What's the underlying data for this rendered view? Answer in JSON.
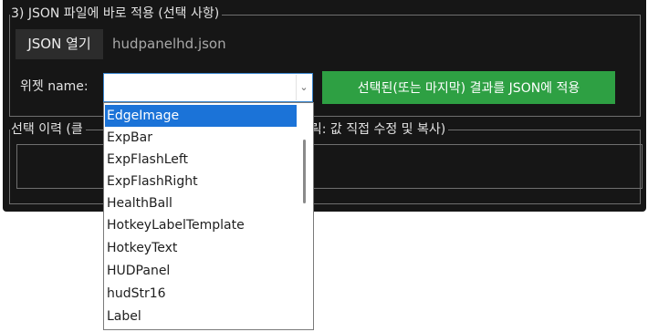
{
  "json_section": {
    "title": "3) JSON 파일에 바로 적용 (선택 사항)",
    "open_button_label": "JSON 열기",
    "filename": "hudpanelhd.json",
    "widget_name_label": "위젯 name:",
    "widget_name_value": "",
    "dropdown_arrow_icon": "chevron-down-icon",
    "apply_button_label": "선택된(또는 마지막) 결과를 JSON에 적용",
    "apply_button_color": "#2ea043"
  },
  "history_section": {
    "title_left": "선택 이력 (클",
    "title_right": "클릭: 값 직접 수정 및 복사)"
  },
  "dropdown": {
    "items": [
      "EdgeImage",
      "ExpBar",
      "ExpFlashLeft",
      "ExpFlashRight",
      "HealthBall",
      "HotkeyLabelTemplate",
      "HotkeyText",
      "HUDPanel",
      "hudStr16",
      "Label"
    ],
    "highlighted_item": "EdgeImage",
    "highlight_color": "#1b73d8"
  }
}
